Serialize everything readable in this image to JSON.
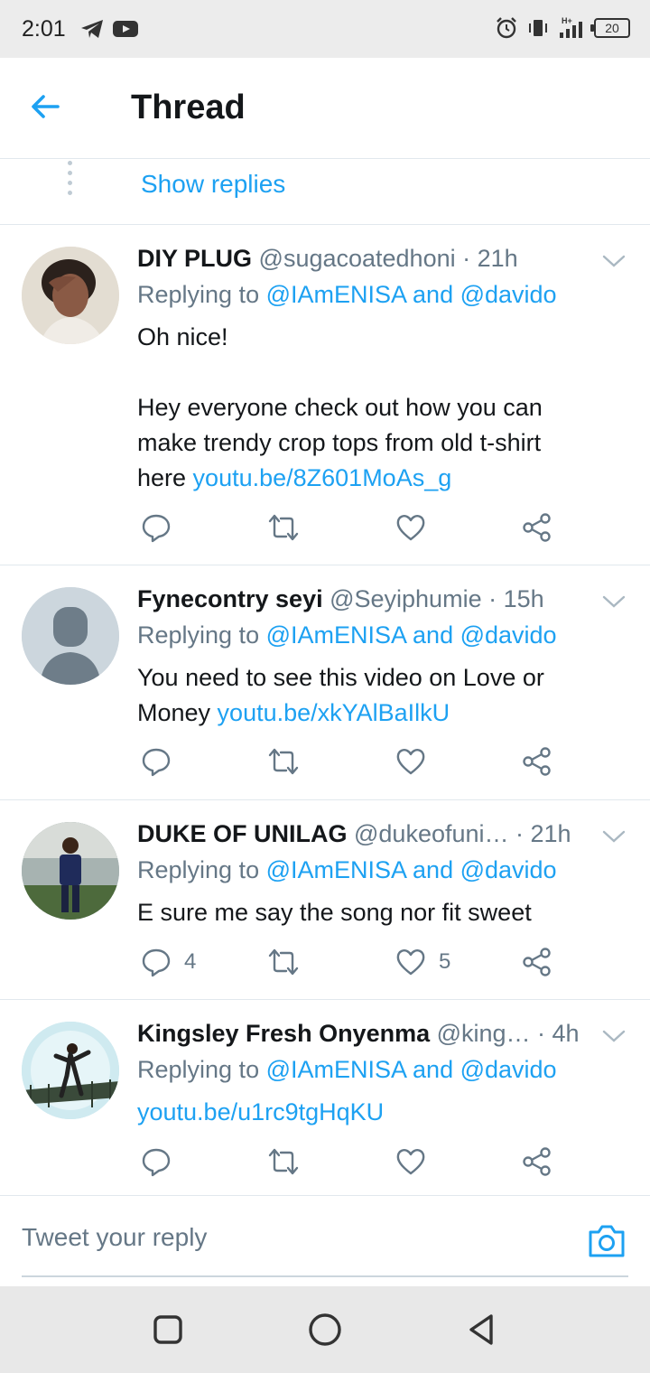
{
  "status_bar": {
    "time": "2:01",
    "battery": "20",
    "net": "H+"
  },
  "header": {
    "title": "Thread"
  },
  "show_replies": {
    "label": "Show replies"
  },
  "tweets": [
    {
      "name": "DIY PLUG",
      "handle_time": " @sugacoatedhoni · 21h",
      "replying_prefix": "Replying to ",
      "replying_to": "@IAmENISA and @davido",
      "text_lines": [
        "Oh nice!",
        "",
        "Hey everyone check out how you can",
        "make trendy crop tops from old t-shirt"
      ],
      "last_line_prefix": "here ",
      "link": "youtu.be/8Z601MoAs_g",
      "reply_count": "",
      "like_count": ""
    },
    {
      "name": "Fynecontry seyi",
      "handle_time": " @Seyiphumie · 15h",
      "replying_prefix": "Replying to ",
      "replying_to": "@IAmENISA and @davido",
      "text_lines": [
        "You need to see this video on Love or"
      ],
      "last_line_prefix": "Money ",
      "link": "youtu.be/xkYAlBaIlkU",
      "reply_count": "",
      "like_count": ""
    },
    {
      "name": "DUKE OF UNILAG",
      "handle_time": " @dukeofuni… · 21h",
      "replying_prefix": "Replying to ",
      "replying_to": "@IAmENISA and @davido",
      "text_lines": [],
      "last_line_prefix": "E sure me say the song nor fit sweet",
      "link": "",
      "reply_count": "4",
      "like_count": "5"
    },
    {
      "name": "Kingsley Fresh Onyenma",
      "handle_time": " @king… · 4h",
      "replying_prefix": "Replying to ",
      "replying_to": "@IAmENISA and @davido",
      "text_lines": [],
      "last_line_prefix": "",
      "link": "youtu.be/u1rc9tgHqKU",
      "reply_count": "",
      "like_count": ""
    }
  ],
  "reply_bar": {
    "placeholder": "Tweet your reply"
  },
  "colors": {
    "accent": "#1da1f2",
    "secondary_text": "#657786",
    "primary_text": "#14171a"
  },
  "icons": [
    "back-arrow-icon",
    "more-dots-icon",
    "chevron-down-icon",
    "reply-icon",
    "retweet-icon",
    "like-icon",
    "share-icon",
    "camera-icon",
    "square-icon",
    "circle-icon",
    "triangle-back-icon"
  ]
}
